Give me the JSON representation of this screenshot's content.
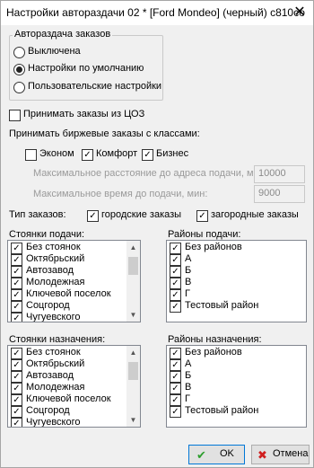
{
  "window": {
    "title": "Настройки автораздачи 02 * [Ford Mondeo] (черный) с810со",
    "close_glyph": "✕"
  },
  "autodistribution": {
    "group_title": "Автораздача заказов",
    "options": [
      {
        "label": "Выключена",
        "checked": false
      },
      {
        "label": "Настройки по умолчанию",
        "checked": true
      },
      {
        "label": "Пользовательские настройки",
        "checked": false
      }
    ]
  },
  "accept_cod": {
    "label": "Принимать заказы из ЦОЗ",
    "checked": false
  },
  "exchange": {
    "label": "Принимать биржевые заказы с классами:",
    "classes": [
      {
        "label": "Эконом",
        "checked": false
      },
      {
        "label": "Комфорт",
        "checked": true
      },
      {
        "label": "Бизнес",
        "checked": true
      }
    ],
    "max_distance_label": "Максимальное расстояние до адреса подачи, м:",
    "max_distance_value": "10000",
    "max_time_label": "Максимальное время до подачи, мин:",
    "max_time_value": "9000"
  },
  "order_type": {
    "label": "Тип заказов:",
    "city": {
      "label": "городские заказы",
      "checked": true
    },
    "suburban": {
      "label": "загородные заказы",
      "checked": true
    }
  },
  "pickup_stands": {
    "label": "Стоянки подачи:",
    "items": [
      "Без стоянок",
      "Октябрьский",
      "Автозавод",
      "Молодежная",
      "Ключевой поселок",
      "Соцгород",
      "Чугуевского"
    ]
  },
  "pickup_districts": {
    "label": "Районы подачи:",
    "items": [
      "Без районов",
      "А",
      "Б",
      "В",
      "Г",
      "Тестовый район"
    ]
  },
  "dest_stands": {
    "label": "Стоянки назначения:",
    "items": [
      "Без стоянок",
      "Октябрьский",
      "Автозавод",
      "Молодежная",
      "Ключевой поселок",
      "Соцгород",
      "Чугуевского"
    ]
  },
  "dest_districts": {
    "label": "Районы назначения:",
    "items": [
      "Без районов",
      "А",
      "Б",
      "В",
      "Г",
      "Тестовый район"
    ]
  },
  "buttons": {
    "ok": {
      "label": "OK",
      "icon": "checkmark-icon",
      "color": "#2e9e2e"
    },
    "cancel": {
      "label": "Отмена",
      "icon": "cross-icon",
      "color": "#d01f1f"
    }
  },
  "check_glyph": "✓"
}
